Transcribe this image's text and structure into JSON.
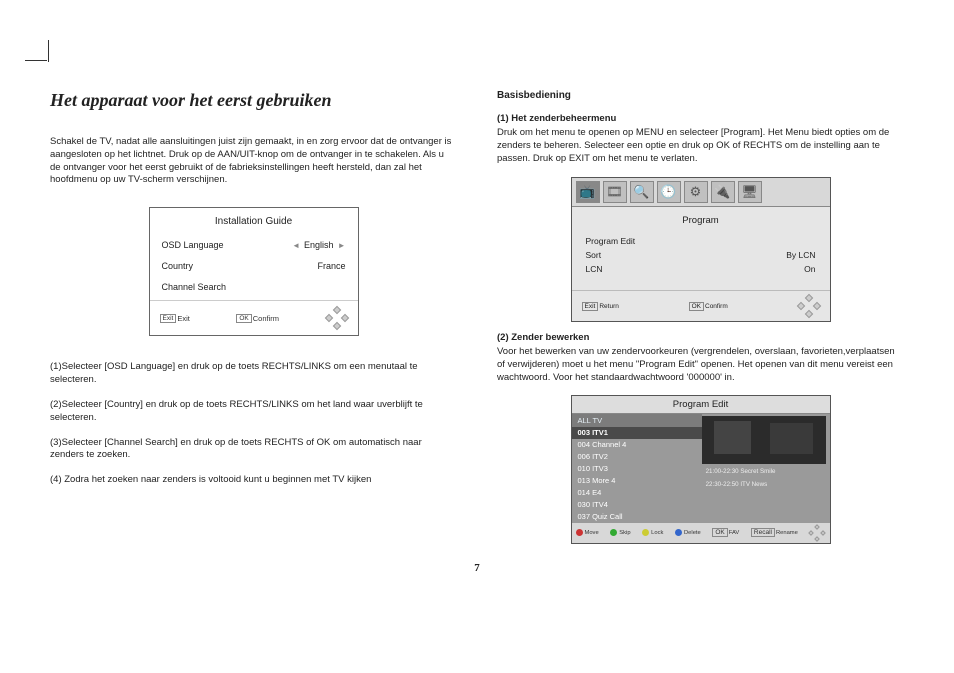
{
  "page_number": "7",
  "left": {
    "title": "Het apparaat voor het eerst gebruiken",
    "intro": "Schakel de TV, nadat alle aansluitingen juist zijn gemaakt, in en zorg ervoor dat de ontvanger is aangesloten op het lichtnet. Druk op de AAN/UIT-knop om de ontvanger in te schakelen. Als u de ontvanger voor het eerst gebruikt of de fabrieksinstellingen heeft hersteld, dan zal het hoofdmenu op uw TV-scherm verschijnen.",
    "install_box": {
      "title": "Installation Guide",
      "rows": [
        {
          "label": "OSD Language",
          "value": "English",
          "arrows": true
        },
        {
          "label": "Country",
          "value": "France",
          "arrows": false
        },
        {
          "label": "Channel Search",
          "value": "",
          "arrows": false
        }
      ],
      "footer": {
        "exit_key": "Exit",
        "exit_label": "Exit",
        "ok_key": "OK",
        "ok_label": "Confirm"
      }
    },
    "steps": [
      "(1)Selecteer [OSD Language] en druk op de toets RECHTS/LINKS om een menutaal te selecteren.",
      "(2)Selecteer [Country] en druk op de toets RECHTS/LINKS om het land waar uverblijft te selecteren.",
      "(3)Selecteer [Channel Search] en druk op de toets RECHTS of OK om automatisch naar zenders te zoeken.",
      "(4) Zodra het zoeken naar zenders is voltooid kunt u beginnen met TV kijken"
    ]
  },
  "right": {
    "h_basic": "Basisbediening",
    "sec1_title": "(1) Het zenderbeheermenu",
    "sec1_body": "Druk om het menu te openen op MENU en selecteer [Program]. Het Menu biedt opties om de zenders te beheren. Selecteer een optie en druk op OK of RECHTS om de instelling aan te passen. Druk op EXIT om het menu te verlaten.",
    "program_menu": {
      "icons": [
        "tv-icon",
        "film-icon",
        "search-icon",
        "clock-icon",
        "gear-icon",
        "usb-icon",
        "monitor-icon"
      ],
      "title": "Program",
      "rows": [
        {
          "label": "Program Edit",
          "value": ""
        },
        {
          "label": "Sort",
          "value": "By LCN"
        },
        {
          "label": "LCN",
          "value": "On"
        }
      ],
      "footer": {
        "exit_key": "Exit",
        "exit_label": "Return",
        "ok_key": "OK",
        "ok_label": "Confirm"
      }
    },
    "sec2_title": "(2)  Zender bewerken",
    "sec2_body": "Voor het bewerken van uw zendervoorkeuren (vergrendelen, overslaan, favorieten,verplaatsen of verwijderen) moet u het menu \"Program Edit\" openen. Het openen van dit menu vereist een wachtwoord. Voor het standaardwachtwoord '000000' in.",
    "program_edit": {
      "title": "Program Edit",
      "list_head": "ALL TV",
      "channels": [
        "003 ITV1",
        "004 Channel 4",
        "006 ITV2",
        "010 ITV3",
        "013 More 4",
        "014 E4",
        "030 ITV4",
        "037 Quiz Call"
      ],
      "epg": [
        "21:00-22:30  Secret Smile",
        "22:30-22:50  ITV News"
      ],
      "footer": [
        "Move",
        "Skip",
        "Lock",
        "Delete",
        "FAV",
        "Rename"
      ],
      "footer_keys": {
        "ok": "OK",
        "recall": "Recall"
      }
    }
  }
}
